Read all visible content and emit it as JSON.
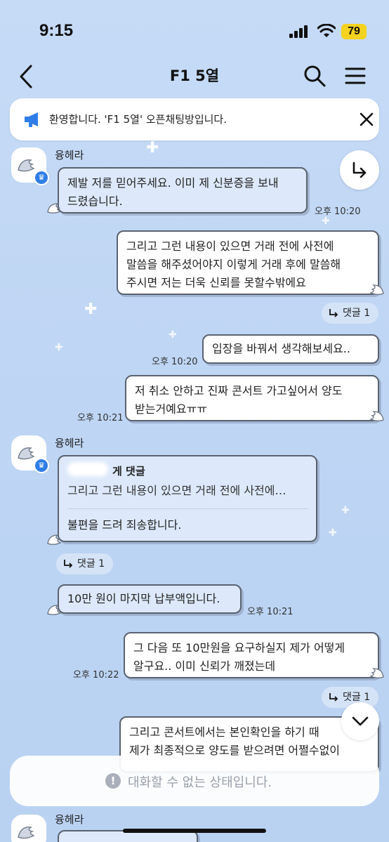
{
  "status_bar": {
    "time": "9:15",
    "battery": "79"
  },
  "header": {
    "title": "F1 5열"
  },
  "notice": {
    "text": "환영합니다. 'F1 5열' 오픈채팅방입니다."
  },
  "messages": [
    {
      "sender": "융헤라",
      "text1": "제발 저를 믿어주세요. 이미 제 신분증을 보내",
      "text2": "드렸습니다.",
      "time": "오후 10:20"
    },
    {
      "text1": "그리고 그런 내용이 있으면 거래 전에 사전에",
      "text2": "말씀을 해주셨어야지 이렇게 거래 후에 말씀해",
      "text3": "주시면 저는 더욱 신뢰를 못할수밖에요",
      "reply": "댓글 1"
    },
    {
      "text": "입장을 바꿔서 생각해보세요..",
      "time": "오후 10:20"
    },
    {
      "text1": "저 취소 안하고 진짜 콘서트 가고싶어서 양도",
      "text2": "받는거예요ㅠㅠ",
      "time": "오후 10:21"
    },
    {
      "sender": "융헤라",
      "quote_head": "게 댓글",
      "quote_body": "그리고 그런 내용이 있으면 거래 전에 사전에…",
      "text": "불편을 드려 죄송합니다.",
      "reply": "댓글 1"
    },
    {
      "text": "10만 원이 마지막 납부액입니다.",
      "time": "오후 10:21"
    },
    {
      "text1": "그 다음 또 10만원을 요구하실지 제가 어떻게",
      "text2": "알구요.. 이미 신뢰가 깨졌는데",
      "time": "오후 10:22",
      "reply": "댓글 1"
    },
    {
      "text1": "그리고 콘서트에서는 본인확인을 하기 때",
      "text2": "제가 최종적으로 양도를 받으려면 어쩔수없이"
    },
    {
      "sender": "융헤라"
    }
  ],
  "input_bar": {
    "disabled_text": "대화할 수 없는 상태입니다.",
    "icon": "!"
  }
}
